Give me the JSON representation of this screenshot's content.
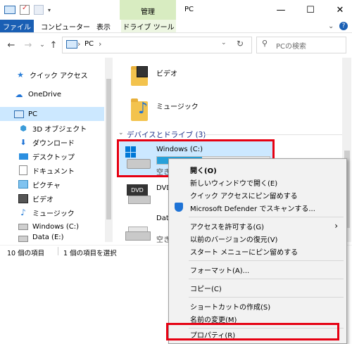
{
  "titlebar": {
    "title": "PC",
    "context_tab": "管理",
    "minimize": "—",
    "maximize": "☐",
    "close": "✕"
  },
  "ribbon": {
    "file": "ファイル",
    "tabs": [
      "コンピューター",
      "表示"
    ],
    "drive_tools": "ドライブ ツール",
    "collapse": "⌄",
    "help": "?"
  },
  "address": {
    "back": "←",
    "forward": "→",
    "history": "⌄",
    "up": "↑",
    "path": "PC",
    "sep": "›",
    "dropdown": "⌄",
    "refresh": "↻",
    "search_placeholder": "PCの検索"
  },
  "sidebar": {
    "items": [
      {
        "label": "クイック アクセス",
        "icon": "star-icon"
      },
      {
        "label": "OneDrive",
        "icon": "cloud-icon"
      },
      {
        "label": "PC",
        "icon": "computer-icon"
      },
      {
        "label": "3D オブジェクト",
        "icon": "3d-objects-icon"
      },
      {
        "label": "ダウンロード",
        "icon": "download-icon"
      },
      {
        "label": "デスクトップ",
        "icon": "desktop-icon"
      },
      {
        "label": "ドキュメント",
        "icon": "document-icon"
      },
      {
        "label": "ピクチャ",
        "icon": "picture-icon"
      },
      {
        "label": "ビデオ",
        "icon": "video-icon"
      },
      {
        "label": "ミュージック",
        "icon": "music-icon"
      },
      {
        "label": "Windows (C:)",
        "icon": "drive-icon"
      },
      {
        "label": "Data (E:)",
        "icon": "drive-icon"
      }
    ]
  },
  "main": {
    "folders": [
      {
        "label": "ビデオ",
        "icon": "video-folder-icon"
      },
      {
        "label": "ミュージック",
        "icon": "music-folder-icon"
      }
    ],
    "group_header": "デバイスとドライブ (3)",
    "group_chevron": "⌄",
    "drives": [
      {
        "label": "Windows (C:)",
        "sub": "空き",
        "icon": "windows-drive-icon",
        "usage": 0.4
      },
      {
        "label": "DVD",
        "icon": "dvd-drive-icon"
      },
      {
        "label": "Dat",
        "sub": "空き",
        "icon": "data-drive-icon"
      }
    ],
    "dvd_badge": "DVD"
  },
  "status": {
    "count": "10 個の項目",
    "selected": "1 個の項目を選択"
  },
  "context_menu": {
    "items": [
      {
        "label": "開く(O)",
        "bold": true
      },
      {
        "label": "新しいウィンドウで開く(E)"
      },
      {
        "label": "クイック アクセスにピン留めする"
      },
      {
        "label": "Microsoft Defender でスキャンする..."
      },
      {
        "label": "アクセスを許可する(G)",
        "submenu": "›"
      },
      {
        "label": "以前のバージョンの復元(V)"
      },
      {
        "label": "スタート メニューにピン留めする"
      },
      {
        "label": "フォーマット(A)..."
      },
      {
        "label": "コピー(C)"
      },
      {
        "label": "ショートカットの作成(S)"
      },
      {
        "label": "名前の変更(M)"
      },
      {
        "label": "プロパティ(R)"
      }
    ]
  },
  "colors": {
    "accent": "#1a5fb4",
    "selection": "#cce8ff",
    "highlight_box": "#e60012",
    "context_tab": "#d8ecc1"
  }
}
